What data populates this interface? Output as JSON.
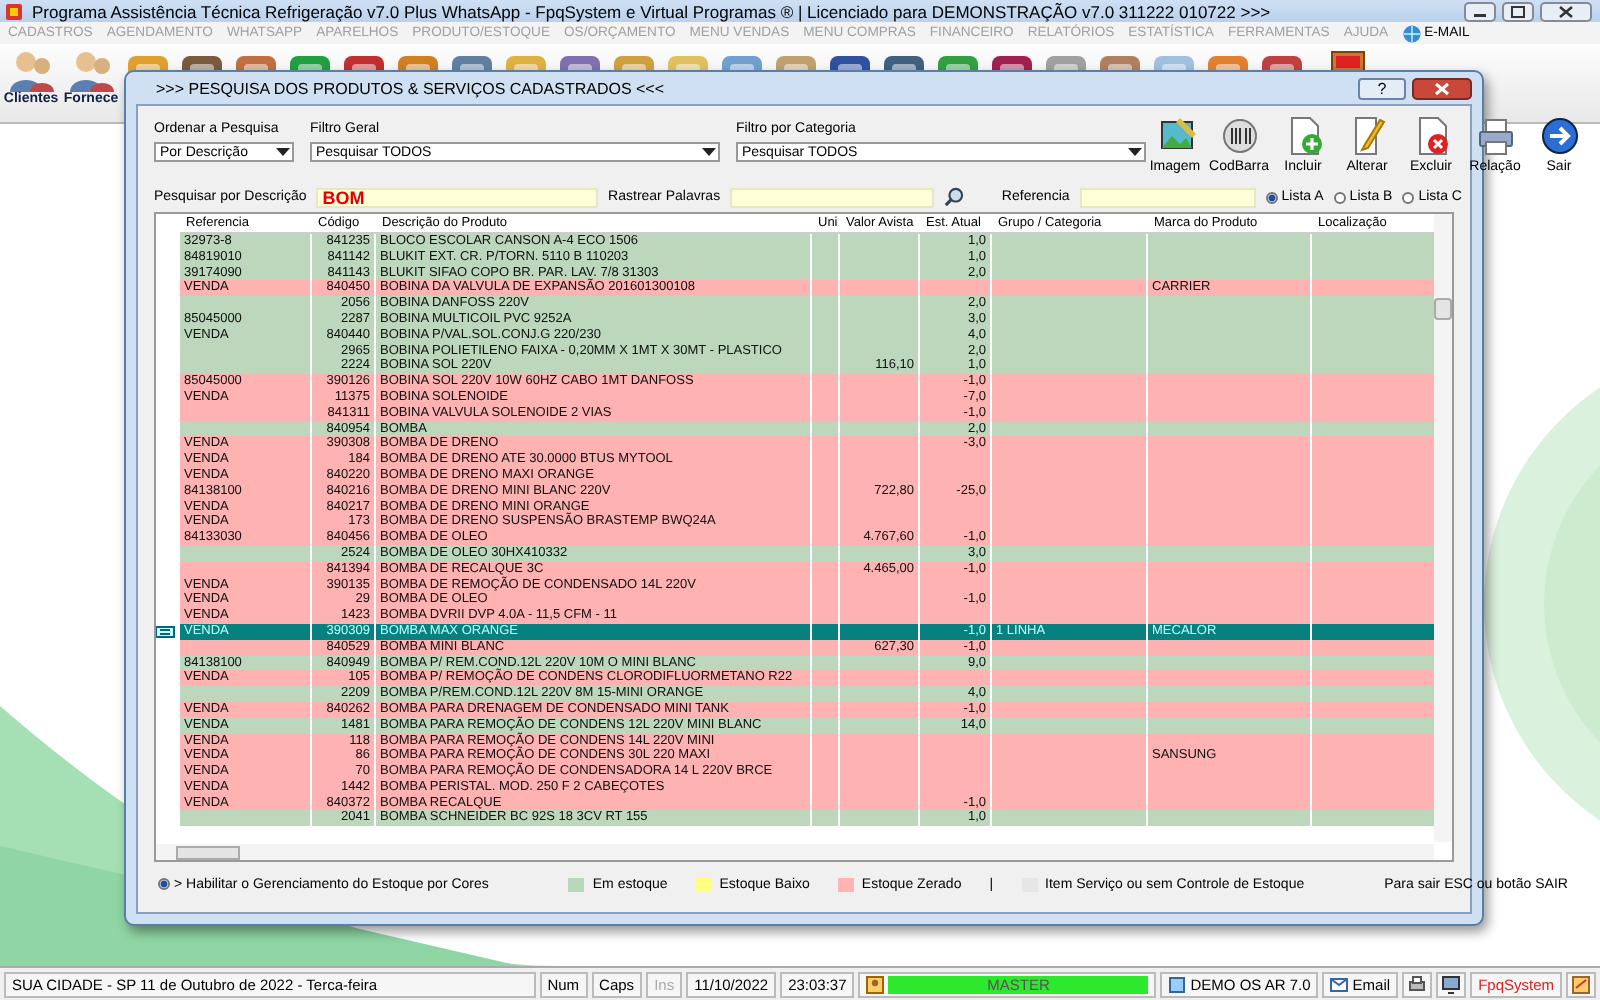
{
  "window": {
    "title": "Programa Assistência Técnica Refrigeração v7.0 Plus WhatsApp - FpqSystem e Virtual Programas ® | Licenciado para  DEMONSTRAÇÃO v7.0 311222 010722 >>>"
  },
  "menu": [
    {
      "label": "CADASTROS",
      "disabled": true
    },
    {
      "label": "AGENDAMENTO",
      "disabled": true
    },
    {
      "label": "WHATSAPP",
      "disabled": true
    },
    {
      "label": "APARELHOS",
      "disabled": true
    },
    {
      "label": "PRODUTO/ESTOQUE",
      "disabled": true
    },
    {
      "label": "OS/ORÇAMENTO",
      "disabled": true
    },
    {
      "label": "MENU VENDAS",
      "disabled": true
    },
    {
      "label": "MENU COMPRAS",
      "disabled": true
    },
    {
      "label": "FINANCEIRO",
      "disabled": true
    },
    {
      "label": "RELATÓRIOS",
      "disabled": true
    },
    {
      "label": "ESTATÍSTICA",
      "disabled": true
    },
    {
      "label": "FERRAMENTAS",
      "disabled": true
    },
    {
      "label": "AJUDA",
      "disabled": true
    },
    {
      "label": "E-MAIL",
      "disabled": false
    }
  ],
  "toolbar": [
    {
      "label": "Clientes"
    },
    {
      "label": "Fornece"
    }
  ],
  "dialog": {
    "title": ">>>  PESQUISA DOS PRODUTOS & SERVIÇOS CADASTRADOS  <<<",
    "help": "?",
    "filters": [
      {
        "label": "Ordenar a Pesquisa",
        "value": "Por Descrição"
      },
      {
        "label": "Filtro Geral",
        "value": "Pesquisar TODOS"
      },
      {
        "label": "Filtro por Categoria",
        "value": "Pesquisar TODOS"
      }
    ],
    "buttons": [
      "Imagem",
      "CodBarra",
      "Incluir",
      "Alterar",
      "Excluir",
      "Relação",
      "Sair"
    ],
    "search": {
      "label": "Pesquisar por Descrição",
      "value": "BOM"
    },
    "track": {
      "label": "Rastrear Palavras"
    },
    "reference": {
      "label": "Referencia"
    },
    "lists": [
      {
        "label": "Lista A",
        "selected": true
      },
      {
        "label": "Lista B",
        "selected": false
      },
      {
        "label": "Lista C",
        "selected": false
      }
    ],
    "table": {
      "columns": [
        "Referencia",
        "Código",
        "Descrição do Produto",
        "Uni",
        "Valor Avista",
        "Est. Atual",
        "Grupo / Categoria",
        "Marca do Produto",
        "Localização"
      ],
      "rows": [
        {
          "reference": "32973-8",
          "code": "841235",
          "description": "BLOCO ESCOLAR CANSON A-4 ECO 1506",
          "stock": "1,0",
          "kind": "in_stock",
          "selected": false
        },
        {
          "reference": "84819010",
          "code": "841142",
          "description": "BLUKIT EXT. CR. P/TORN. 5110 B 110203",
          "stock": "1,0",
          "kind": "in_stock",
          "selected": false
        },
        {
          "reference": "39174090",
          "code": "841143",
          "description": "BLUKIT SIFAO COPO BR. PAR. LAV. 7/8 31303",
          "stock": "2,0",
          "kind": "in_stock",
          "selected": false
        },
        {
          "reference": "VENDA",
          "code": "840450",
          "description": "BOBINA DA VALVULA DE EXPANSÃO 201601300108",
          "brand": "CARRIER",
          "kind": "zero_stock",
          "selected": false
        },
        {
          "code": "2056",
          "description": "BOBINA DANFOSS 220V",
          "stock": "2,0",
          "kind": "in_stock",
          "selected": false
        },
        {
          "reference": "85045000",
          "code": "2287",
          "description": "BOBINA MULTICOIL PVC 9252A",
          "stock": "3,0",
          "kind": "in_stock",
          "selected": false
        },
        {
          "reference": "VENDA",
          "code": "840440",
          "description": "BOBINA P/VAL.SOL.CONJ.G 220/230",
          "stock": "4,0",
          "kind": "in_stock",
          "selected": false
        },
        {
          "code": "2965",
          "description": "BOBINA POLIETILENO FAIXA - 0,20MM X 1MT X 30MT - PLASTICO",
          "stock": "2,0",
          "kind": "in_stock",
          "selected": false
        },
        {
          "code": "2224",
          "description": "BOBINA SOL 220V",
          "price": "116,10",
          "stock": "1,0",
          "kind": "in_stock",
          "selected": false
        },
        {
          "reference": "85045000",
          "code": "390126",
          "description": "BOBINA SOL 220V 10W 60HZ CABO 1MT DANFOSS",
          "stock": "-1,0",
          "kind": "zero_stock",
          "selected": false
        },
        {
          "reference": "VENDA",
          "code": "11375",
          "description": "BOBINA SOLENOIDE",
          "stock": "-7,0",
          "kind": "zero_stock",
          "selected": false
        },
        {
          "code": "841311",
          "description": "BOBINA VALVULA SOLENOIDE 2 VIAS",
          "stock": "-1,0",
          "kind": "zero_stock",
          "selected": false
        },
        {
          "code": "840954",
          "description": "BOMBA",
          "stock": "2,0",
          "kind": "in_stock",
          "selected": false
        },
        {
          "reference": "VENDA",
          "code": "390308",
          "description": "BOMBA DE DRENO",
          "stock": "-3,0",
          "kind": "zero_stock",
          "selected": false
        },
        {
          "reference": "VENDA",
          "code": "184",
          "description": "BOMBA DE DRENO ATE 30.0000 BTUS MYTOOL",
          "kind": "zero_stock",
          "selected": false
        },
        {
          "reference": "VENDA",
          "code": "840220",
          "description": "BOMBA DE DRENO MAXI ORANGE",
          "kind": "zero_stock",
          "selected": false
        },
        {
          "reference": "84138100",
          "code": "840216",
          "description": "BOMBA DE DRENO MINI BLANC 220V",
          "price": "722,80",
          "stock": "-25,0",
          "kind": "zero_stock",
          "selected": false
        },
        {
          "reference": "VENDA",
          "code": "840217",
          "description": "BOMBA DE DRENO MINI ORANGE",
          "kind": "zero_stock",
          "selected": false
        },
        {
          "reference": "VENDA",
          "code": "173",
          "description": "BOMBA DE DRENO SUSPENSÃO BRASTEMP BWQ24A",
          "kind": "zero_stock",
          "selected": false
        },
        {
          "reference": "84133030",
          "code": "840456",
          "description": "BOMBA DE OLEO",
          "price": "4.767,60",
          "stock": "-1,0",
          "kind": "zero_stock",
          "selected": false
        },
        {
          "code": "2524",
          "description": "BOMBA DE OLEO 30HX410332",
          "stock": "3,0",
          "kind": "in_stock",
          "selected": false
        },
        {
          "code": "841394",
          "description": "BOMBA DE RECALQUE 3C",
          "price": "4.465,00",
          "stock": "-1,0",
          "kind": "zero_stock",
          "selected": false
        },
        {
          "reference": "VENDA",
          "code": "390135",
          "description": "BOMBA DE REMOÇÃO DE CONDENSADO 14L 220V",
          "kind": "zero_stock",
          "selected": false
        },
        {
          "reference": "VENDA",
          "code": "29",
          "description": "BOMBA DE OLEO",
          "stock": "-1,0",
          "kind": "zero_stock",
          "selected": false
        },
        {
          "reference": "VENDA",
          "code": "1423",
          "description": "BOMBA DVRII DVP 4.0A - 11,5 CFM - 11",
          "kind": "zero_stock",
          "selected": false
        },
        {
          "reference": "VENDA",
          "code": "390309",
          "description": "BOMBA MAX ORANGE",
          "stock": "-1,0",
          "group": "1 LINHA",
          "brand": "MECALOR",
          "kind": "zero_stock",
          "selected": true
        },
        {
          "code": "840529",
          "description": "BOMBA MINI BLANC",
          "price": "627,30",
          "stock": "-1,0",
          "kind": "zero_stock",
          "selected": false
        },
        {
          "reference": "84138100",
          "code": "840949",
          "description": "BOMBA P/ REM.COND.12L 220V 10M O MINI BLANC",
          "stock": "9,0",
          "kind": "in_stock",
          "selected": false
        },
        {
          "reference": "VENDA",
          "code": "105",
          "description": "BOMBA P/ REMOÇÃO DE CONDENS CLORODIFLUORMETANO R22",
          "kind": "zero_stock",
          "selected": false
        },
        {
          "code": "2209",
          "description": "BOMBA P/REM.COND.12L 220V 8M 15-MINI ORANGE",
          "stock": "4,0",
          "kind": "in_stock",
          "selected": false
        },
        {
          "reference": "VENDA",
          "code": "840262",
          "description": "BOMBA PARA DRENAGEM DE CONDENSADO MINI TANK",
          "stock": "-1,0",
          "kind": "zero_stock",
          "selected": false
        },
        {
          "reference": "VENDA",
          "code": "1481",
          "description": "BOMBA PARA REMOÇÃO DE CONDENS 12L 220V MINI BLANC",
          "stock": "14,0",
          "kind": "in_stock",
          "selected": false
        },
        {
          "reference": "VENDA",
          "code": "118",
          "description": "BOMBA PARA REMOÇÃO DE CONDENS 14L 220V MINI",
          "kind": "zero_stock",
          "selected": false
        },
        {
          "reference": "VENDA",
          "code": "86",
          "description": "BOMBA PARA REMOÇÃO DE CONDENS 30L 220 MAXI",
          "brand": "SANSUNG",
          "kind": "zero_stock",
          "selected": false
        },
        {
          "reference": "VENDA",
          "code": "70",
          "description": "BOMBA PARA REMOÇÃO DE CONDENSADORA 14 L 220V BRCE",
          "kind": "zero_stock",
          "selected": false
        },
        {
          "reference": "VENDA",
          "code": "1442",
          "description": "BOMBA PERISTAL. MOD. 250 F 2 CABEÇOTES",
          "kind": "zero_stock",
          "selected": false
        },
        {
          "reference": "VENDA",
          "code": "840372",
          "description": "BOMBA RECALQUE",
          "stock": "-1,0",
          "kind": "zero_stock",
          "selected": false
        },
        {
          "code": "2041",
          "description": "BOMBA SCHNEIDER  BC 92S 18 3CV RT 155",
          "stock": "1,0",
          "kind": "in_stock",
          "selected": false
        }
      ]
    },
    "color_option": {
      "label": "> Habilitar o Gerenciamento do Estoque por Cores",
      "checked": true
    },
    "legend": [
      {
        "label": "Em estoque",
        "color": "#b9d8b9"
      },
      {
        "label": "Estoque Baixo",
        "color": "#ffff80"
      },
      {
        "label": "Estoque Zerado",
        "color": "#ffb3b3"
      },
      {
        "label": "Item Serviço ou sem Controle de Estoque",
        "color": "#e6e6e6",
        "separator": "|"
      }
    ],
    "exit_hint": "Para sair ESC ou botão SAIR"
  },
  "status_bar": {
    "location": "SUA CIDADE - SP 11 de Outubro de 2022 - Terca-feira",
    "keys": [
      {
        "label": "Num",
        "disabled": false
      },
      {
        "label": "Caps",
        "disabled": false
      },
      {
        "label": "Ins",
        "disabled": true
      }
    ],
    "date": "11/10/2022",
    "time": "23:03:37",
    "user": "MASTER",
    "company": "DEMO OS AR 7.0",
    "email": "Email",
    "brand": "FpqSystem"
  }
}
